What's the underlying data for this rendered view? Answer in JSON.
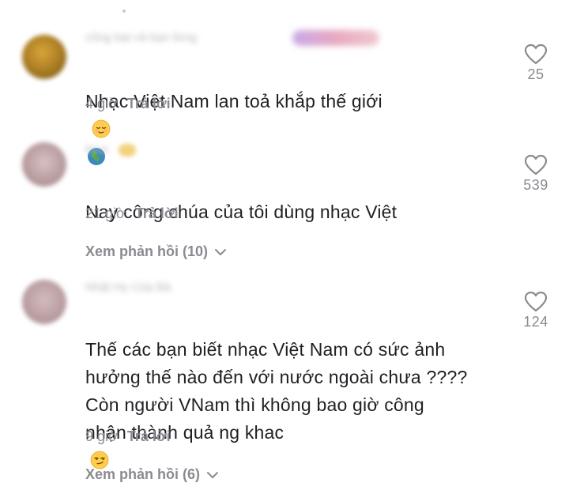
{
  "comments": [
    {
      "username": "công bạt và bạn lừng",
      "text": "Nhạc Việt Nam lan toả khắp thế giới",
      "emojis": [
        "relieved-face",
        "globe-asia"
      ],
      "time": "4 giờ",
      "reply_label": "Trả lời",
      "likes": "25"
    },
    {
      "username": "Mon",
      "text": "Nay công chúa của tôi dùng nhạc Việt",
      "emojis": [],
      "time": "21 giờ",
      "reply_label": "Trả lời",
      "likes": "539",
      "view_replies": "Xem phản hồi (10)"
    },
    {
      "username": "Nhật Hy Của Bà",
      "text": "Thế các bạn biết nhạc Việt Nam có sức ảnh\nhưởng thế nào đến với nước ngoài chưa ????\nCòn người VNam thì không bao giờ công\nnhận thành quả ng khac",
      "emojis": [
        "smirking-face"
      ],
      "time": "9 giờ",
      "reply_label": "Trả lời",
      "likes": "124",
      "view_replies": "Xem phản hồi (6)"
    }
  ],
  "colors": {
    "text": "#1f1f24",
    "muted": "#8a8b91",
    "background": "#ffffff",
    "heart": "#8a8b91"
  }
}
